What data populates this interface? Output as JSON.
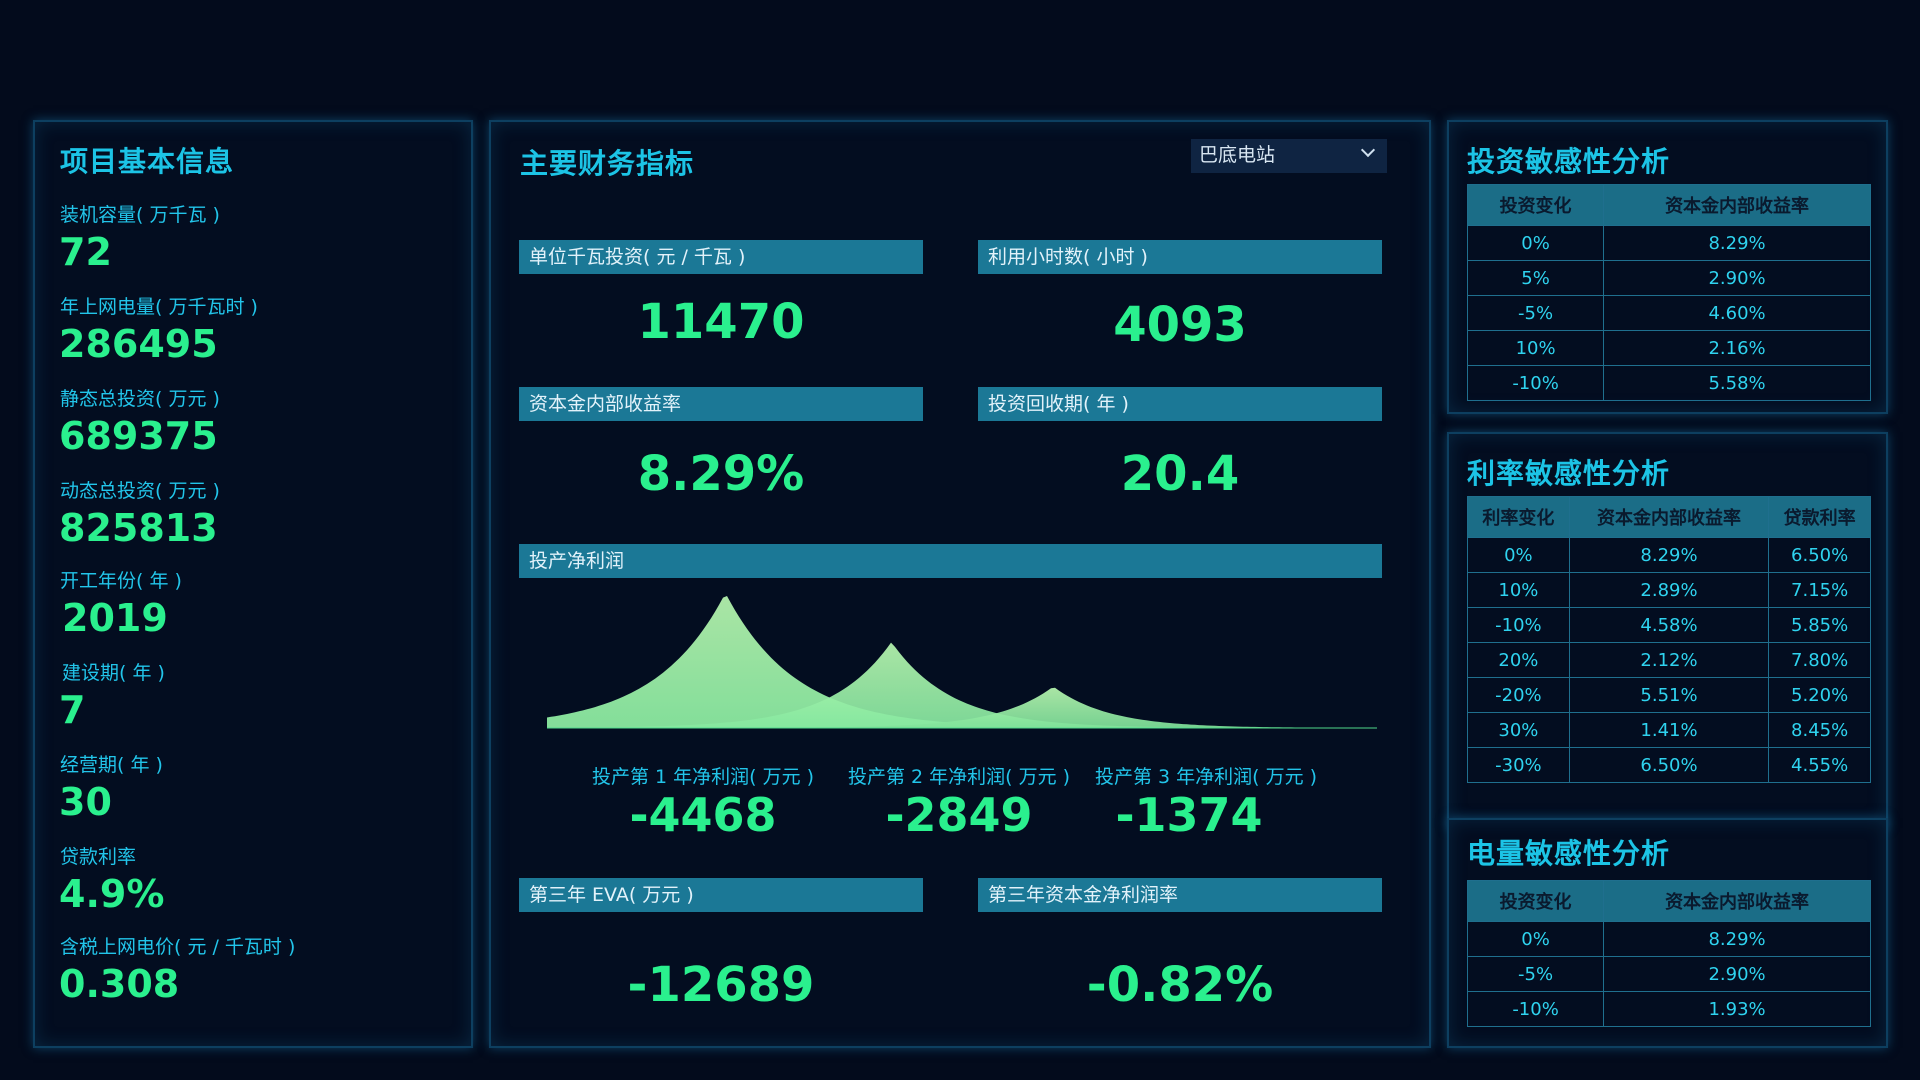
{
  "left": {
    "title": "项目基本信息",
    "items": [
      {
        "label": "装机容量( 万千瓦 )",
        "value": "72"
      },
      {
        "label": "年上网电量( 万千瓦时 )",
        "value": "286495"
      },
      {
        "label": "静态总投资( 万元 )",
        "value": "689375"
      },
      {
        "label": "动态总投资( 万元 )",
        "value": "825813"
      },
      {
        "label": "开工年份( 年 )",
        "value": "2019"
      },
      {
        "label": "建设期( 年 )",
        "value": "7"
      },
      {
        "label": "经营期( 年 )",
        "value": "30"
      },
      {
        "label": "贷款利率",
        "value": "4.9%"
      },
      {
        "label": "含税上网电价( 元 / 千瓦时 )",
        "value": "0.308"
      }
    ]
  },
  "mid": {
    "title": "主要财务指标",
    "station_select": "巴底电站",
    "kpis": [
      {
        "label": "单位千瓦投资( 元 / 千瓦 )",
        "value": "11470"
      },
      {
        "label": "利用小时数( 小时 )",
        "value": "4093"
      },
      {
        "label": "资本金内部收益率",
        "value": "8.29%"
      },
      {
        "label": "投资回收期( 年 )",
        "value": "20.4"
      }
    ],
    "profit": {
      "label": "投产净利润",
      "years": [
        {
          "label": "投产第 1 年净利润( 万元 )",
          "value": "-4468"
        },
        {
          "label": "投产第 2 年净利润( 万元 )",
          "value": "-2849"
        },
        {
          "label": "投产第 3 年净利润( 万元 )",
          "value": "-1374"
        }
      ]
    },
    "bottom": [
      {
        "label": "第三年 EVA( 万元 )",
        "value": "-12689"
      },
      {
        "label": "第三年资本金净利润率",
        "value": "-0.82%"
      }
    ]
  },
  "chart_data": {
    "type": "area",
    "series": [
      {
        "values": [
          4468,
          2849,
          1374
        ]
      }
    ]
  },
  "colors": {
    "accent": "#2af08e",
    "title": "#1cc4e6",
    "bar": "#1b7896",
    "background": "#030b1c"
  },
  "r1": {
    "title": "投资敏感性分析",
    "headers": [
      "投资变化",
      "资本金内部收益率"
    ],
    "rows": [
      [
        "0%",
        "8.29%"
      ],
      [
        "5%",
        "2.90%"
      ],
      [
        "-5%",
        "4.60%"
      ],
      [
        "10%",
        "2.16%"
      ],
      [
        "-10%",
        "5.58%"
      ]
    ]
  },
  "r2": {
    "title": "利率敏感性分析",
    "headers": [
      "利率变化",
      "资本金内部收益率",
      "贷款利率"
    ],
    "rows": [
      [
        "0%",
        "8.29%",
        "6.50%"
      ],
      [
        "10%",
        "2.89%",
        "7.15%"
      ],
      [
        "-10%",
        "4.58%",
        "5.85%"
      ],
      [
        "20%",
        "2.12%",
        "7.80%"
      ],
      [
        "-20%",
        "5.51%",
        "5.20%"
      ],
      [
        "30%",
        "1.41%",
        "8.45%"
      ],
      [
        "-30%",
        "6.50%",
        "4.55%"
      ]
    ]
  },
  "r3": {
    "title": "电量敏感性分析",
    "headers": [
      "投资变化",
      "资本金内部收益率"
    ],
    "rows": [
      [
        "0%",
        "8.29%"
      ],
      [
        "-5%",
        "2.90%"
      ],
      [
        "-10%",
        "1.93%"
      ]
    ]
  }
}
